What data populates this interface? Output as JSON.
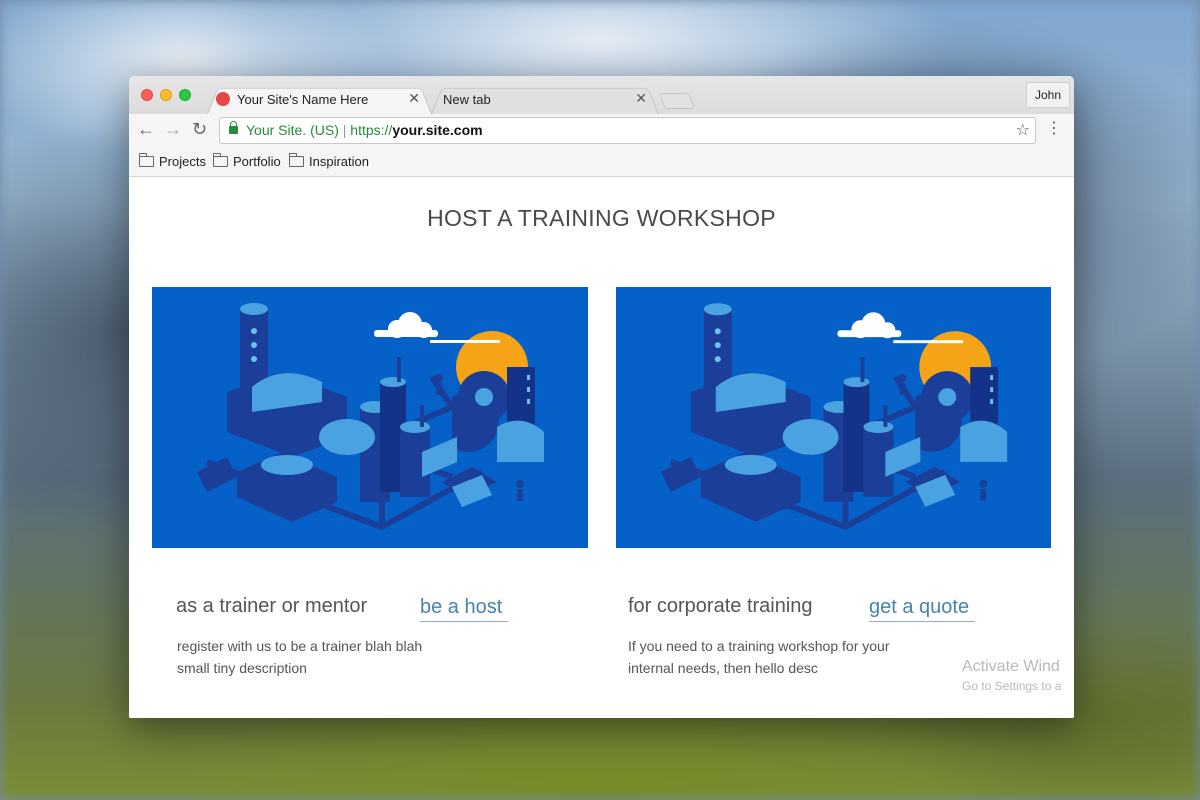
{
  "browser": {
    "tabs": [
      {
        "title": "Your Site's Name Here",
        "active": true
      },
      {
        "title": "New tab",
        "active": false
      }
    ],
    "tab_close_glyph": "✕",
    "profile_name": "John",
    "nav": {
      "back": "←",
      "forward": "→",
      "reload": "↻"
    },
    "address": {
      "secure_label": "Your Site. (US)",
      "separator": "|",
      "scheme": "https://",
      "host": "your.site.com"
    },
    "star_glyph": "☆",
    "menu_glyph": "⋮",
    "bookmarks": [
      "Projects",
      "Portfolio",
      "Inspiration"
    ]
  },
  "page": {
    "title": "HOST A TRAINING WORKSHOP",
    "cards": [
      {
        "heading": "as a trainer or mentor",
        "link": "be a host",
        "desc_line1": "register with us to be a trainer blah blah",
        "desc_line2": "small tiny description"
      },
      {
        "heading": "for corporate training",
        "link": "get a quote",
        "desc_line1": "If you need to a training workshop for your",
        "desc_line2": "internal needs, then hello desc"
      }
    ]
  },
  "watermark": {
    "title": "Activate Wind",
    "subtitle": "Go to Settings to a"
  },
  "colors": {
    "illustration_bg": "#0561c8",
    "link": "#4683b0",
    "secure_green": "#2a8a3c",
    "favicon": "#e84545",
    "sun": "#f5a417"
  },
  "icons": [
    "favicon-icon",
    "close-icon",
    "back-arrow-icon",
    "forward-arrow-icon",
    "reload-icon",
    "lock-icon",
    "star-icon",
    "menu-icon",
    "folder-icon",
    "industrial-illustration"
  ]
}
